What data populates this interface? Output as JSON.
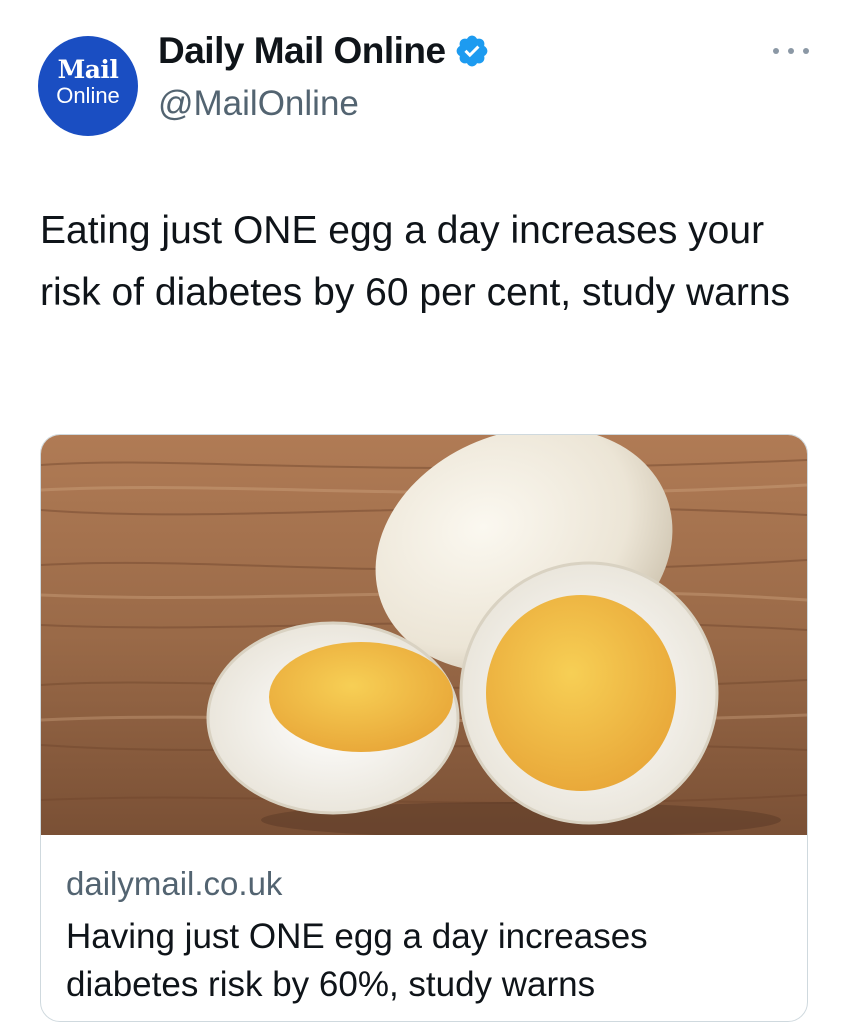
{
  "account": {
    "avatar_line1": "Mail",
    "avatar_line2": "Online",
    "display_name": "Daily Mail Online",
    "handle": "@MailOnline",
    "verified": true,
    "avatar_color": "#1a4ec2",
    "verified_color": "#1d9bf0"
  },
  "tweet": {
    "text": "Eating just ONE egg a day increases your risk of diabetes by 60 per cent, study warns"
  },
  "card": {
    "image_icon": "boiled-eggs-photo",
    "domain": "dailymail.co.uk",
    "title": "Having just ONE egg a day increases diabetes risk by 60%, study warns"
  },
  "icons": {
    "more": "more-horizontal-icon",
    "verified": "verified-badge-icon"
  }
}
